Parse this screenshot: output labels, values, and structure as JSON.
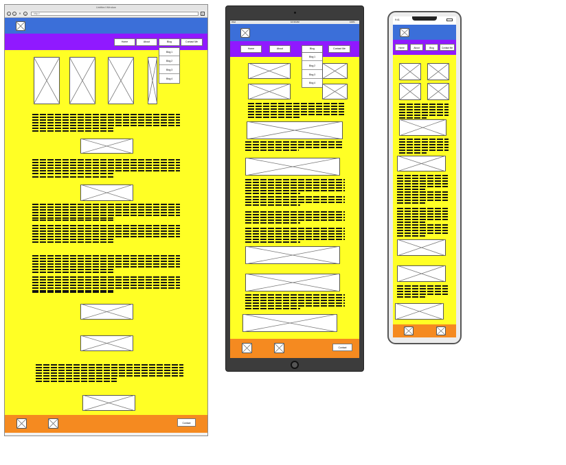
{
  "desktop": {
    "window_title": "Untitled Window",
    "url": "http://",
    "nav": [
      "Home",
      "About",
      "Blog",
      "Contact Me"
    ],
    "dropdown": [
      "Blog 1",
      "Blog 2",
      "Blog 3",
      "Blog 4"
    ],
    "footer_button": "Contact"
  },
  "tablet": {
    "status_left": "iPad",
    "status_time": "10:30 AM",
    "status_right": "100%",
    "nav": [
      "Home",
      "About",
      "Blog",
      "Contact Me"
    ],
    "dropdown": [
      "Blog 1",
      "Blog 2",
      "Blog 3",
      "Blog 4"
    ],
    "footer_button": "Contact"
  },
  "phone": {
    "status_time": "9:41",
    "nav": [
      "Home",
      "About",
      "Blog",
      "Contact Me"
    ]
  },
  "colors": {
    "page_background": "#ffff25",
    "header": "#3b6fd9",
    "nav_bar": "#9019ff",
    "footer": "#f58a20"
  },
  "icons": {
    "logo": "image-placeholder-icon",
    "placeholder": "image-placeholder-icon"
  }
}
